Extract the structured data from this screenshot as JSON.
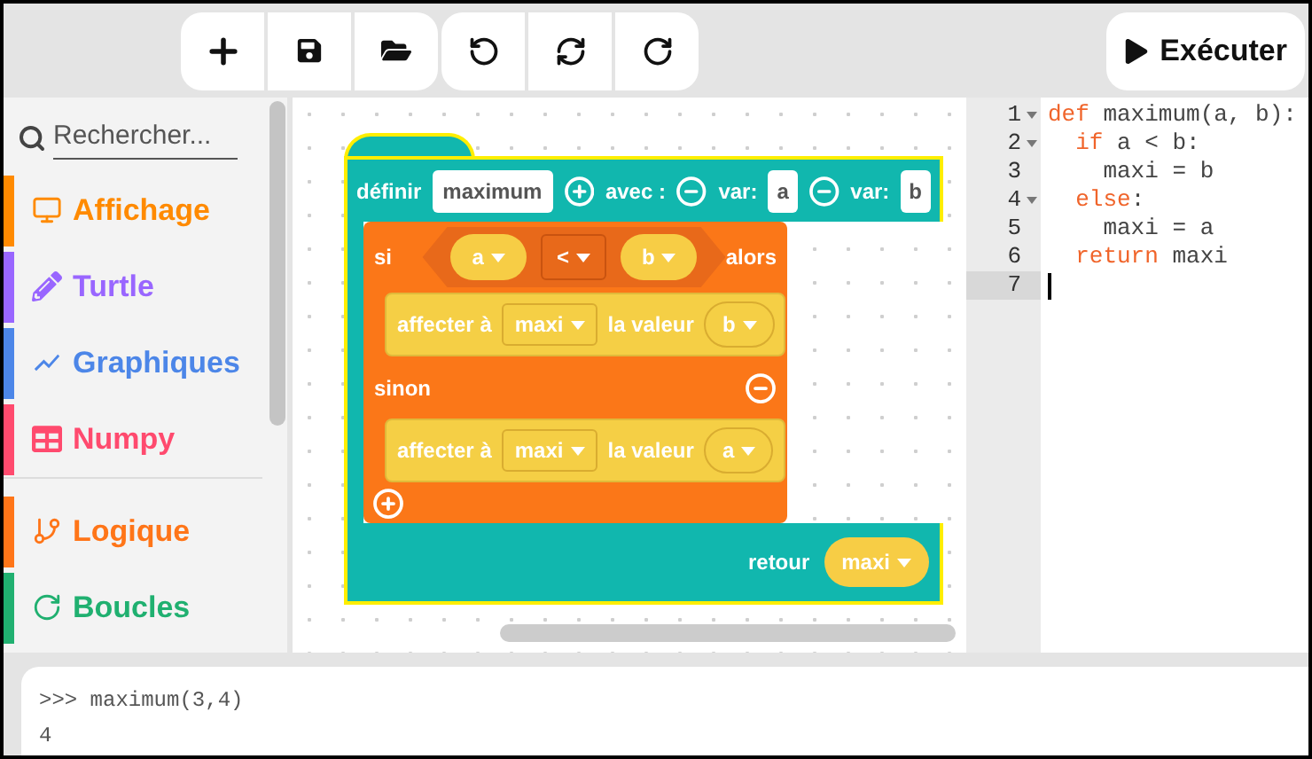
{
  "run_button": {
    "label": "Exécuter"
  },
  "sidebar": {
    "search": {
      "placeholder": "Rechercher..."
    },
    "category_groups": [
      {
        "items": [
          {
            "label": "Affichage",
            "color": "#ff8a00"
          },
          {
            "label": "Turtle",
            "color": "#9966ff"
          },
          {
            "label": "Graphiques",
            "color": "#4c86e8"
          },
          {
            "label": "Numpy",
            "color": "#ff4a6e"
          }
        ]
      },
      {
        "items": [
          {
            "label": "Logique",
            "color": "#ff7518"
          },
          {
            "label": "Boucles",
            "color": "#20b070"
          }
        ]
      }
    ]
  },
  "function_block": {
    "keyword": "définir",
    "name": "maximum",
    "params_label": "avec :",
    "params": [
      {
        "label": "var:",
        "name": "a"
      },
      {
        "label": "var:",
        "name": "b"
      }
    ],
    "if_block": {
      "keyword": "si",
      "condition": {
        "left": "a",
        "operator": "<",
        "right": "b"
      },
      "then_label": "alors",
      "then": [
        {
          "label": "affecter à",
          "variable": "maxi",
          "value_label": "la valeur",
          "value": "b"
        }
      ],
      "else_label": "sinon",
      "else": [
        {
          "label": "affecter à",
          "variable": "maxi",
          "value_label": "la valeur",
          "value": "a"
        }
      ]
    },
    "return_label": "retour",
    "return_value": "maxi"
  },
  "editor": {
    "lines": [
      {
        "number": "1",
        "foldable": true,
        "active": false,
        "segments": [
          {
            "text": "def",
            "kind": "keyword"
          },
          {
            "text": " maximum(a, b):",
            "kind": "plain"
          }
        ]
      },
      {
        "number": "2",
        "foldable": true,
        "active": false,
        "segments": [
          {
            "text": "  if",
            "kind": "keyword"
          },
          {
            "text": " a < b:",
            "kind": "plain"
          }
        ]
      },
      {
        "number": "3",
        "foldable": false,
        "active": false,
        "segments": [
          {
            "text": "    maxi = b",
            "kind": "plain"
          }
        ]
      },
      {
        "number": "4",
        "foldable": true,
        "active": false,
        "segments": [
          {
            "text": "  else",
            "kind": "keyword"
          },
          {
            "text": ":",
            "kind": "plain"
          }
        ]
      },
      {
        "number": "5",
        "foldable": false,
        "active": false,
        "segments": [
          {
            "text": "    maxi = a",
            "kind": "plain"
          }
        ]
      },
      {
        "number": "6",
        "foldable": false,
        "active": false,
        "segments": [
          {
            "text": "  return",
            "kind": "keyword"
          },
          {
            "text": " maxi",
            "kind": "plain"
          }
        ]
      },
      {
        "number": "7",
        "foldable": false,
        "active": true
      }
    ]
  },
  "console": {
    "lines": [
      ">>> maximum(3,4)",
      "4"
    ]
  }
}
